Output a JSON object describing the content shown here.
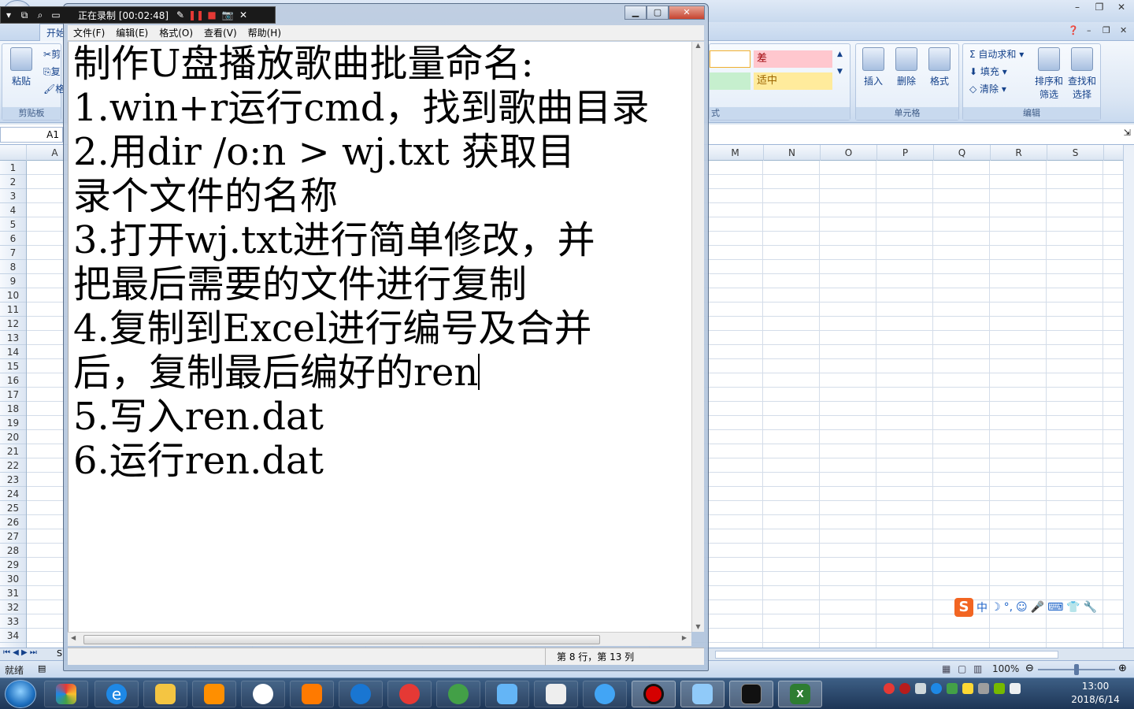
{
  "recorder": {
    "status": "正在录制 [00:02:48]"
  },
  "notepad": {
    "menu": [
      "文件(F)",
      "编辑(E)",
      "格式(O)",
      "查看(V)",
      "帮助(H)"
    ],
    "lines": [
      "制作U盘播放歌曲批量命名:",
      "1.win+r运行cmd，找到歌曲目录",
      "2.用dir /o:n > wj.txt 获取目",
      "录个文件的名称",
      "3.打开wj.txt进行简单修改，并",
      "把最后需要的文件进行复制",
      "4.复制到Excel进行编号及合并",
      "后，复制最后编好的ren",
      "5.写入ren.dat",
      "6.运行ren.dat"
    ],
    "status_position": "第 8 行，第 13 列"
  },
  "excel": {
    "home_tab": "开始",
    "ribbon": {
      "paste": "粘贴",
      "cut": "剪",
      "copy": "复",
      "format_painter": "格",
      "clipboard_group": "剪贴板",
      "style_bad": "差",
      "style_neutral": "适中",
      "styles_group_tail": "式",
      "insert": "插入",
      "delete": "删除",
      "format": "格式",
      "cells_group": "单元格",
      "autosum": "自动求和",
      "fill": "填充",
      "clear": "清除",
      "sort_filter_1": "排序和",
      "sort_filter_2": "筛选",
      "find_select_1": "查找和",
      "find_select_2": "选择",
      "editing_group": "编辑"
    },
    "name_box": "A1",
    "columns_visible": [
      "A",
      "M",
      "N",
      "O",
      "P",
      "Q",
      "R",
      "S"
    ],
    "rows": [
      "1",
      "2",
      "3",
      "4",
      "5",
      "6",
      "7",
      "8",
      "9",
      "10",
      "11",
      "12",
      "13",
      "14",
      "15",
      "16",
      "17",
      "18",
      "19",
      "20",
      "21",
      "22",
      "23",
      "24",
      "25",
      "26",
      "27",
      "28",
      "29",
      "30",
      "31",
      "32",
      "33",
      "34"
    ],
    "sheet_tab_partial": "S",
    "status_ready": "就绪",
    "zoom": "100%",
    "colors": {
      "bad_bg": "#ffc7ce",
      "bad_fg": "#9c0006",
      "neutral_bg": "#ffeb9c",
      "neutral_fg": "#9c6500"
    }
  },
  "ime": {
    "items": [
      "中",
      "☽",
      "°,",
      "☺",
      "🎤",
      "⌨",
      "👕",
      "🔧"
    ]
  },
  "taskbar": {
    "apps": [
      "ie-browser",
      "file-explorer",
      "media-player",
      "baidu-netdisk",
      "xiami-music",
      "kugou-music",
      "netease-music",
      "refresh-app",
      "feishu-app",
      "fox-app",
      "arrow-app",
      "recorder-app",
      "notepad",
      "cmd",
      "excel"
    ],
    "time": "13:00",
    "date": "2018/6/14"
  }
}
